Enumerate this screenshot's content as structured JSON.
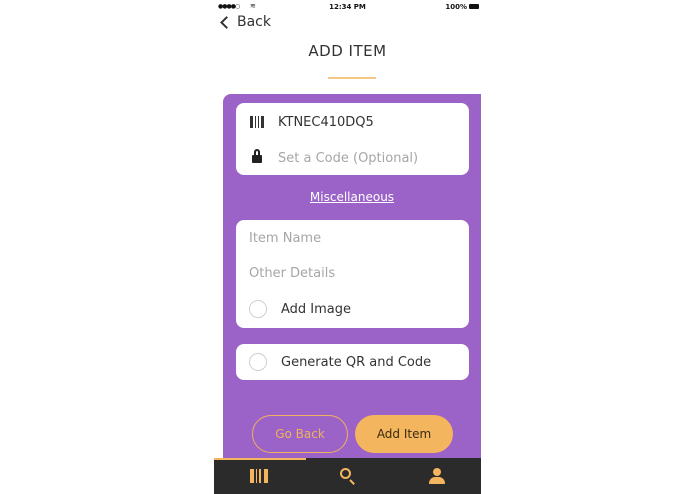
{
  "status_bar": {
    "signal": "●●●●○",
    "time": "12:34 PM",
    "battery": "100%"
  },
  "nav": {
    "back_label": "Back",
    "title": "ADD ITEM"
  },
  "code_box": {
    "code_value": "KTNEC410DQ5",
    "set_code_placeholder": "Set a Code (Optional)"
  },
  "category_link": "Miscellaneous",
  "item_box": {
    "item_name_placeholder": "Item Name",
    "other_details_placeholder": "Other Details",
    "add_image_label": "Add Image"
  },
  "qr_box": {
    "generate_label": "Generate QR and Code"
  },
  "buttons": {
    "go_back": "Go Back",
    "add_item": "Add Item"
  },
  "tabbar": {
    "tabs": [
      {
        "icon": "barcode-icon",
        "active": true
      },
      {
        "icon": "search-icon",
        "active": false
      },
      {
        "icon": "profile-icon",
        "active": false
      }
    ]
  },
  "colors": {
    "purple": "#9b63c7",
    "accent": "#f4b55f",
    "tabbar": "#2b2b2b"
  }
}
